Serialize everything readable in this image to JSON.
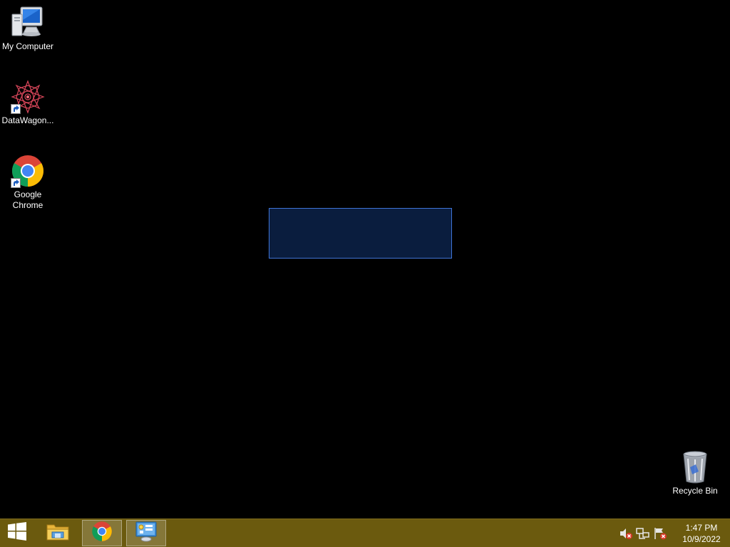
{
  "desktop": {
    "icons": [
      {
        "label": "My Computer",
        "icon": "computer-icon",
        "shortcut": false
      },
      {
        "label": "DataWagon...",
        "icon": "datawagon-icon",
        "shortcut": true
      },
      {
        "label": "Google Chrome",
        "icon": "chrome-icon",
        "shortcut": true
      }
    ],
    "recycle_bin": {
      "label": "Recycle Bin",
      "icon": "recycle-bin-icon"
    },
    "selection_color": "#3f74d6"
  },
  "taskbar": {
    "color": "#6b5a0e",
    "start": {
      "icon": "windows-logo-icon"
    },
    "pinned": [
      {
        "name": "file-explorer",
        "icon": "folder-icon",
        "active": false
      },
      {
        "name": "google-chrome",
        "icon": "chrome-icon",
        "active": true
      },
      {
        "name": "control-panel",
        "icon": "control-panel-icon",
        "active": true
      }
    ],
    "tray": {
      "icons": [
        "speaker-muted-icon",
        "network-icon",
        "action-center-flag-icon"
      ],
      "time": "1:47 PM",
      "date": "10/9/2022"
    }
  }
}
